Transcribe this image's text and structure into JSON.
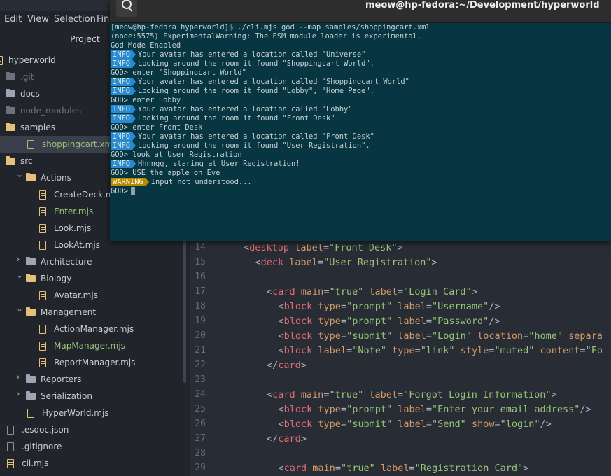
{
  "menu": {
    "edit": "Edit",
    "view": "View",
    "selection": "Selection",
    "find": "Fin"
  },
  "project": {
    "title": "Project",
    "root": "hyperworld",
    "items": [
      {
        "label": ".git",
        "kind": "folder-dim",
        "depth": 0
      },
      {
        "label": "docs",
        "kind": "folder",
        "depth": 0
      },
      {
        "label": "node_modules",
        "kind": "folder-dim",
        "depth": 0
      },
      {
        "label": "samples",
        "kind": "folder-open",
        "depth": 0
      },
      {
        "label": "shoppingcart.xml",
        "kind": "file-xml",
        "depth": 1
      },
      {
        "label": "src",
        "kind": "folder-open",
        "depth": 0
      },
      {
        "label": "Actions",
        "kind": "folder-open",
        "depth": 1
      },
      {
        "label": "CreateDeck.mjs",
        "kind": "file",
        "depth": 2
      },
      {
        "label": "Enter.mjs",
        "kind": "file-green",
        "depth": 2
      },
      {
        "label": "Look.mjs",
        "kind": "file",
        "depth": 2
      },
      {
        "label": "LookAt.mjs",
        "kind": "file",
        "depth": 2
      },
      {
        "label": "Architecture",
        "kind": "folder",
        "depth": 1
      },
      {
        "label": "Biology",
        "kind": "folder-open",
        "depth": 1
      },
      {
        "label": "Avatar.mjs",
        "kind": "file",
        "depth": 2
      },
      {
        "label": "Management",
        "kind": "folder-open",
        "depth": 1
      },
      {
        "label": "ActionManager.mjs",
        "kind": "file",
        "depth": 2
      },
      {
        "label": "MapManager.mjs",
        "kind": "file-green",
        "depth": 2
      },
      {
        "label": "ReportManager.mjs",
        "kind": "file",
        "depth": 2
      },
      {
        "label": "Reporters",
        "kind": "folder",
        "depth": 1
      },
      {
        "label": "Serialization",
        "kind": "folder",
        "depth": 1
      },
      {
        "label": "HyperWorld.mjs",
        "kind": "file",
        "depth": 1
      },
      {
        "label": ".esdoc.json",
        "kind": "file-gray",
        "depth": 0
      },
      {
        "label": ".gitignore",
        "kind": "file-gray",
        "depth": 0
      },
      {
        "label": "cli.mjs",
        "kind": "file",
        "depth": 0
      }
    ]
  },
  "editor": {
    "line_numbers": [
      "14",
      "15",
      "16",
      "17",
      "18",
      "19",
      "20",
      "21",
      "22",
      "23",
      "24",
      "25",
      "26",
      "27",
      "28",
      "29"
    ],
    "lines": [
      {
        "indent": 1,
        "parts": [
          [
            "pn",
            "<"
          ],
          [
            "tg",
            "desktop"
          ],
          [
            "pn",
            " "
          ],
          [
            "at",
            "label"
          ],
          [
            "pn",
            "="
          ],
          [
            "st",
            "\"Front Desk\""
          ],
          [
            "pn",
            ">"
          ]
        ]
      },
      {
        "indent": 2,
        "parts": [
          [
            "pn",
            "<"
          ],
          [
            "tg",
            "deck"
          ],
          [
            "pn",
            " "
          ],
          [
            "at",
            "label"
          ],
          [
            "pn",
            "="
          ],
          [
            "st",
            "\"User Registration\""
          ],
          [
            "pn",
            ">"
          ]
        ]
      },
      {
        "indent": 0,
        "parts": []
      },
      {
        "indent": 3,
        "parts": [
          [
            "pn",
            "<"
          ],
          [
            "tg",
            "card"
          ],
          [
            "pn",
            " "
          ],
          [
            "at",
            "main"
          ],
          [
            "pn",
            "="
          ],
          [
            "st",
            "\"true\""
          ],
          [
            "pn",
            " "
          ],
          [
            "at",
            "label"
          ],
          [
            "pn",
            "="
          ],
          [
            "st",
            "\"Login Card\""
          ],
          [
            "pn",
            ">"
          ]
        ]
      },
      {
        "indent": 4,
        "parts": [
          [
            "pn",
            "<"
          ],
          [
            "tg",
            "block"
          ],
          [
            "pn",
            " "
          ],
          [
            "at",
            "type"
          ],
          [
            "pn",
            "="
          ],
          [
            "st",
            "\"prompt\""
          ],
          [
            "pn",
            " "
          ],
          [
            "at",
            "label"
          ],
          [
            "pn",
            "="
          ],
          [
            "st",
            "\"Username\""
          ],
          [
            "pn",
            "/>"
          ]
        ]
      },
      {
        "indent": 4,
        "parts": [
          [
            "pn",
            "<"
          ],
          [
            "tg",
            "block"
          ],
          [
            "pn",
            " "
          ],
          [
            "at",
            "type"
          ],
          [
            "pn",
            "="
          ],
          [
            "st",
            "\"prompt\""
          ],
          [
            "pn",
            " "
          ],
          [
            "at",
            "label"
          ],
          [
            "pn",
            "="
          ],
          [
            "st",
            "\"Password\""
          ],
          [
            "pn",
            "/>"
          ]
        ]
      },
      {
        "indent": 4,
        "parts": [
          [
            "pn",
            "<"
          ],
          [
            "tg",
            "block"
          ],
          [
            "pn",
            " "
          ],
          [
            "at",
            "type"
          ],
          [
            "pn",
            "="
          ],
          [
            "st",
            "\"submit\""
          ],
          [
            "pn",
            " "
          ],
          [
            "at",
            "label"
          ],
          [
            "pn",
            "="
          ],
          [
            "st",
            "\"Login\""
          ],
          [
            "pn",
            " "
          ],
          [
            "at",
            "location"
          ],
          [
            "pn",
            "="
          ],
          [
            "st",
            "\"home\""
          ],
          [
            "pn",
            " "
          ],
          [
            "at",
            "separa"
          ]
        ]
      },
      {
        "indent": 4,
        "parts": [
          [
            "pn",
            "<"
          ],
          [
            "tg",
            "block"
          ],
          [
            "pn",
            " "
          ],
          [
            "at",
            "label"
          ],
          [
            "pn",
            "="
          ],
          [
            "st",
            "\"Note\""
          ],
          [
            "pn",
            " "
          ],
          [
            "at",
            "type"
          ],
          [
            "pn",
            "="
          ],
          [
            "st",
            "\"link\""
          ],
          [
            "pn",
            " "
          ],
          [
            "at",
            "style"
          ],
          [
            "pn",
            "="
          ],
          [
            "st",
            "\"muted\""
          ],
          [
            "pn",
            " "
          ],
          [
            "at",
            "content"
          ],
          [
            "pn",
            "="
          ],
          [
            "st",
            "\"Fo"
          ]
        ]
      },
      {
        "indent": 3,
        "parts": [
          [
            "pn",
            "</"
          ],
          [
            "tg",
            "card"
          ],
          [
            "pn",
            ">"
          ]
        ]
      },
      {
        "indent": 0,
        "parts": []
      },
      {
        "indent": 3,
        "parts": [
          [
            "pn",
            "<"
          ],
          [
            "tg",
            "card"
          ],
          [
            "pn",
            " "
          ],
          [
            "at",
            "main"
          ],
          [
            "pn",
            "="
          ],
          [
            "st",
            "\"true\""
          ],
          [
            "pn",
            " "
          ],
          [
            "at",
            "label"
          ],
          [
            "pn",
            "="
          ],
          [
            "st",
            "\"Forgot Login Information\""
          ],
          [
            "pn",
            ">"
          ]
        ]
      },
      {
        "indent": 4,
        "parts": [
          [
            "pn",
            "<"
          ],
          [
            "tg",
            "block"
          ],
          [
            "pn",
            " "
          ],
          [
            "at",
            "type"
          ],
          [
            "pn",
            "="
          ],
          [
            "st",
            "\"prompt\""
          ],
          [
            "pn",
            " "
          ],
          [
            "at",
            "label"
          ],
          [
            "pn",
            "="
          ],
          [
            "st",
            "\"Enter your email address\""
          ],
          [
            "pn",
            "/>"
          ]
        ]
      },
      {
        "indent": 4,
        "parts": [
          [
            "pn",
            "<"
          ],
          [
            "tg",
            "block"
          ],
          [
            "pn",
            " "
          ],
          [
            "at",
            "type"
          ],
          [
            "pn",
            "="
          ],
          [
            "st",
            "\"submit\""
          ],
          [
            "pn",
            " "
          ],
          [
            "at",
            "label"
          ],
          [
            "pn",
            "="
          ],
          [
            "st",
            "\"Send\""
          ],
          [
            "pn",
            " "
          ],
          [
            "at",
            "show"
          ],
          [
            "pn",
            "="
          ],
          [
            "st",
            "\"login\""
          ],
          [
            "pn",
            "/>"
          ]
        ]
      },
      {
        "indent": 3,
        "parts": [
          [
            "pn",
            "</"
          ],
          [
            "tg",
            "card"
          ],
          [
            "pn",
            ">"
          ]
        ]
      },
      {
        "indent": 0,
        "parts": []
      },
      {
        "indent": 4,
        "parts": [
          [
            "pn",
            "<"
          ],
          [
            "tg",
            "card"
          ],
          [
            "pn",
            " "
          ],
          [
            "at",
            "main"
          ],
          [
            "pn",
            "="
          ],
          [
            "st",
            "\"true\""
          ],
          [
            "pn",
            " "
          ],
          [
            "at",
            "label"
          ],
          [
            "pn",
            "="
          ],
          [
            "st",
            "\"Registration Card\""
          ],
          [
            "pn",
            ">"
          ]
        ]
      }
    ]
  },
  "terminal": {
    "title": "meow@hp-fedora:~/Development/hyperworld",
    "search_icon": "search-icon",
    "lines": [
      {
        "badge": "",
        "text": "[meow@hp-fedora hyperworld]$ ./cli.mjs god --map samples/shoppingcart.xml"
      },
      {
        "badge": "",
        "text": "(node:5575) ExperimentalWarning: The ESM module loader is experimental."
      },
      {
        "badge": "",
        "text": "God Mode Enabled"
      },
      {
        "badge": "INFO",
        "text": "Your avatar has entered a location called \"Universe\""
      },
      {
        "badge": "INFO",
        "text": "Looking around the room it found \"Shoppingcart World\"."
      },
      {
        "badge": "",
        "text": "GOD> enter \"Shoppingcart World\""
      },
      {
        "badge": "INFO",
        "text": "Your avatar has entered a location called \"Shoppingcart World\""
      },
      {
        "badge": "INFO",
        "text": "Looking around the room it found \"Lobby\", \"Home Page\"."
      },
      {
        "badge": "",
        "text": "GOD> enter Lobby"
      },
      {
        "badge": "INFO",
        "text": "Your avatar has entered a location called \"Lobby\""
      },
      {
        "badge": "INFO",
        "text": "Looking around the room it found \"Front Desk\"."
      },
      {
        "badge": "",
        "text": "GOD> enter Front Desk"
      },
      {
        "badge": "INFO",
        "text": "Your avatar has entered a location called \"Front Desk\""
      },
      {
        "badge": "INFO",
        "text": "Looking around the room it found \"User Registration\"."
      },
      {
        "badge": "",
        "text": "GOD> look at User Registration"
      },
      {
        "badge": "INFO",
        "text": "Hhnngg, staring at User Registration!"
      },
      {
        "badge": "",
        "text": "GOD> USE the apple on Eve"
      },
      {
        "badge": "WARNING",
        "text": "Input not understood..."
      }
    ],
    "prompt": "GOD>"
  }
}
